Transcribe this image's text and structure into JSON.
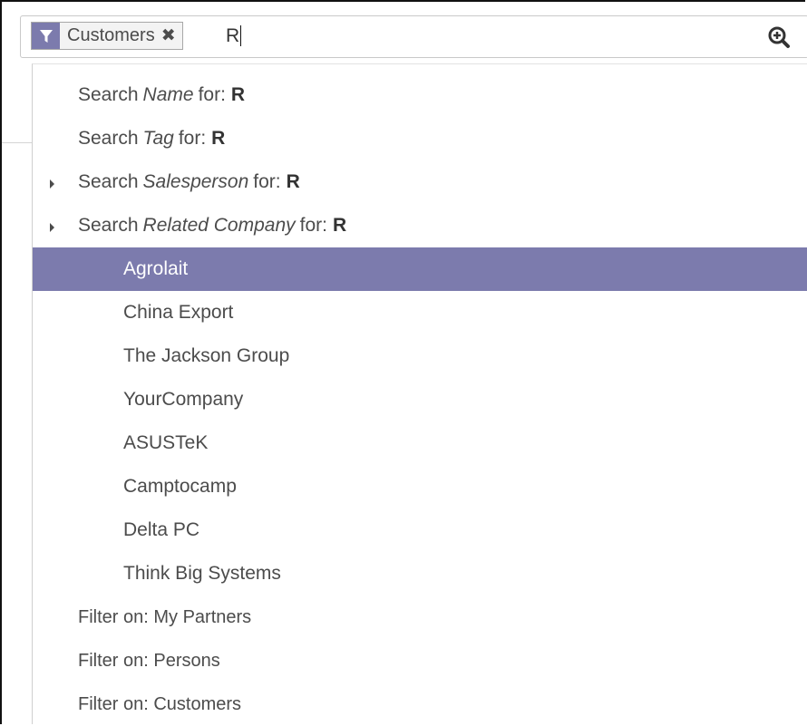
{
  "search": {
    "facet": {
      "icon": "filter-icon",
      "value": "Customers",
      "remove_icon": "close-icon"
    },
    "query": "R",
    "button_icon": "zoom-in-icon"
  },
  "autocomplete": {
    "field_items": [
      {
        "prefix": "Search",
        "field": "Name",
        "suffix": "for:",
        "term": "R",
        "expandable": false
      },
      {
        "prefix": "Search",
        "field": "Tag",
        "suffix": "for:",
        "term": "R",
        "expandable": false
      },
      {
        "prefix": "Search",
        "field": "Salesperson",
        "suffix": "for:",
        "term": "R",
        "expandable": true
      },
      {
        "prefix": "Search",
        "field": "Related Company",
        "suffix": "for:",
        "term": "R",
        "expandable": true
      }
    ],
    "related_company_options": [
      "Agrolait",
      "China Export",
      "The Jackson Group",
      "YourCompany",
      "ASUSTeK",
      "Camptocamp",
      "Delta PC",
      "Think Big Systems"
    ],
    "selected_option": "Agrolait",
    "filters": [
      "Filter on: My Partners",
      "Filter on: Persons",
      "Filter on: Customers"
    ]
  },
  "colors": {
    "accent": "#7c7bad",
    "text": "#4c4c4c",
    "border": "#c9c9c9"
  }
}
